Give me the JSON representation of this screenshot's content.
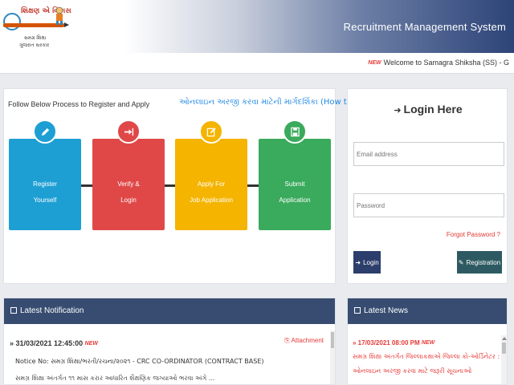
{
  "header": {
    "logo_title": "શિક્ષણ એ વિકાસ",
    "logo_sub1": "સમગ્ર શિક્ષા",
    "logo_sub2": "ગુજરાત સરકાર",
    "app_title": "Recruitment Management System"
  },
  "ticker": {
    "badge": "NEW",
    "text": "Welcome to Samagra Shiksha (SS) - G"
  },
  "process": {
    "heading": "Follow Below Process to Register and Apply",
    "gujarati_link": "ઓનલાઇન અરજી કરવા માટેની માર્ગદર્શિકા (How to Apply?)",
    "steps": [
      {
        "line1": "Register",
        "line2": "Yourself",
        "color": "#1e9fd4",
        "icon": "pencil-icon"
      },
      {
        "line1": "Verify &",
        "line2": "Login",
        "color": "#e04848",
        "icon": "login-icon"
      },
      {
        "line1": "Apply For",
        "line2": "Job Application",
        "color": "#f4b400",
        "icon": "edit-icon"
      },
      {
        "line1": "Submit",
        "line2": "Application",
        "color": "#3aaa5c",
        "icon": "save-icon"
      }
    ]
  },
  "login": {
    "title": "Login Here",
    "email_placeholder": "Email address",
    "password_placeholder": "Password",
    "forgot": "Forgot Password ?",
    "login_label": "Login",
    "register_label": "Registration"
  },
  "notifications": {
    "title": "Latest Notification",
    "date": "31/03/2021 12:45:00",
    "badge": "NEW",
    "attachment": "Attachment",
    "subject": "Notice No: સમગ્ર શિક્ષા/ભરતી/રચના/૨૦૨૧ - CRC CO-ORDINATOR (CONTRACT BASE)",
    "description": "સમગ્ર શિક્ષા અંતર્ગત ૧૧ માસ કરાર આધારિત શૈક્ષણિક જગ્યાઓ ભરવા અંગે ..."
  },
  "news": {
    "title": "Latest News",
    "date": "17/03/2021 08:00 PM",
    "badge": "NEW",
    "desc1": "સમગ્ર શિક્ષા અંતર્ગત જિલ્લાકક્ષાએ જિલ્લા કો-ઓર્ડિનેટર :",
    "desc2": "ઓનલાઇન અરજી કરવા માટે જરૂરી સૂચનાઓ"
  },
  "colors": {
    "panel_header": "#374c70",
    "login_button": "#2c3e6b",
    "register_button": "#2d5a62",
    "accent_red": "#e53935"
  }
}
